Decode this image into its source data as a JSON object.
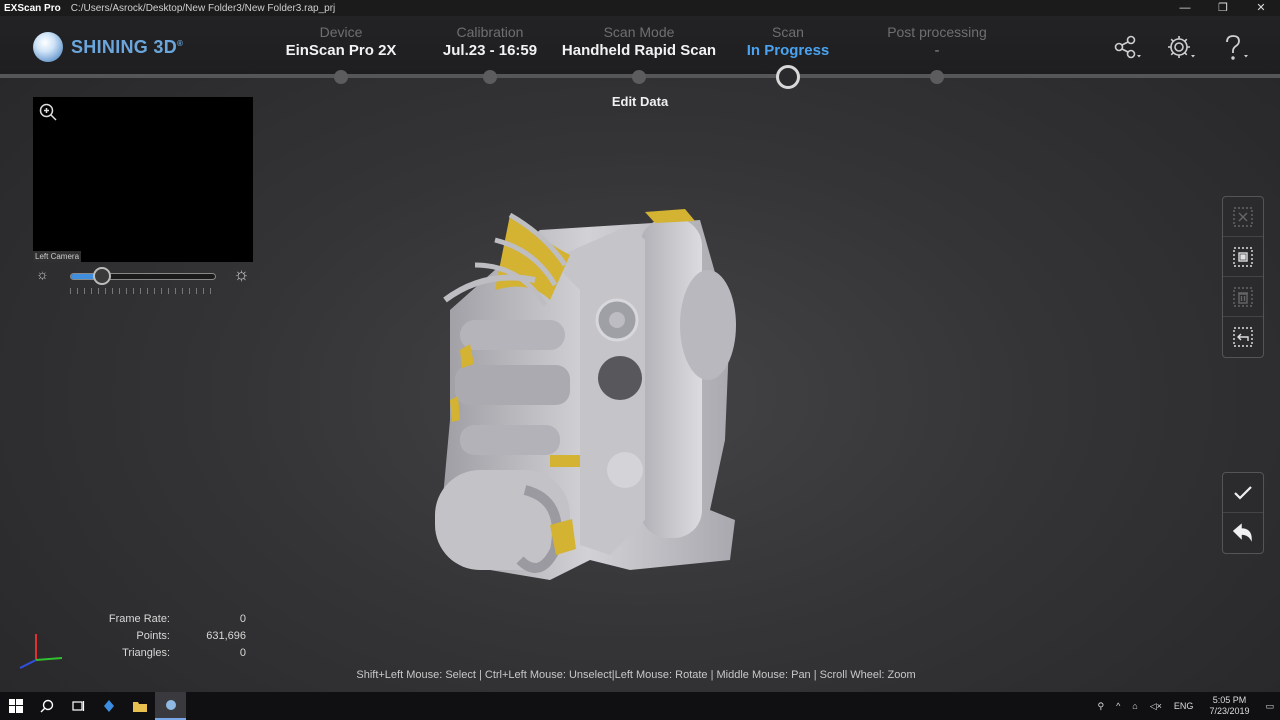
{
  "window": {
    "app_name": "EXScan Pro",
    "path": "C:/Users/Asrock/Desktop/New Folder3/New Folder3.rap_prj",
    "minimize": "—",
    "maximize": "❐",
    "close": "✕"
  },
  "brand": {
    "name": "SHINING 3D",
    "mark": "®"
  },
  "steps": [
    {
      "label": "Device",
      "value": "EinScan Pro 2X",
      "state": "done"
    },
    {
      "label": "Calibration",
      "value": "Jul.23 - 16:59",
      "state": "done"
    },
    {
      "label": "Scan Mode",
      "value": "Handheld Rapid Scan",
      "state": "done"
    },
    {
      "label": "Scan",
      "value": "In Progress",
      "state": "current"
    },
    {
      "label": "Post processing",
      "value": "-",
      "state": "pending"
    }
  ],
  "header_icons": [
    "share-icon",
    "settings-icon",
    "help-icon"
  ],
  "edit_title": "Edit Data",
  "camera": {
    "label": "Left Camera",
    "brightness_fraction": 0.22
  },
  "edit_tools": [
    "deselect-icon",
    "select-through-icon",
    "delete-selection-icon",
    "invert-selection-icon"
  ],
  "action_tools": [
    "confirm-icon",
    "undo-icon"
  ],
  "stats": [
    {
      "key": "Frame Rate:",
      "value": "0"
    },
    {
      "key": "Points:",
      "value": "631,696"
    },
    {
      "key": "Triangles:",
      "value": "0"
    }
  ],
  "hint": "Shift+Left Mouse: Select | Ctrl+Left Mouse: Unselect|Left Mouse: Rotate | Middle Mouse: Pan | Scroll Wheel: Zoom",
  "taskbar": {
    "language": "ENG",
    "time": "5:05 PM",
    "date": "7/23/2019"
  },
  "colors": {
    "accent": "#4aa3f0",
    "highlight": "#d4b232",
    "model": "#c8c8cc"
  }
}
